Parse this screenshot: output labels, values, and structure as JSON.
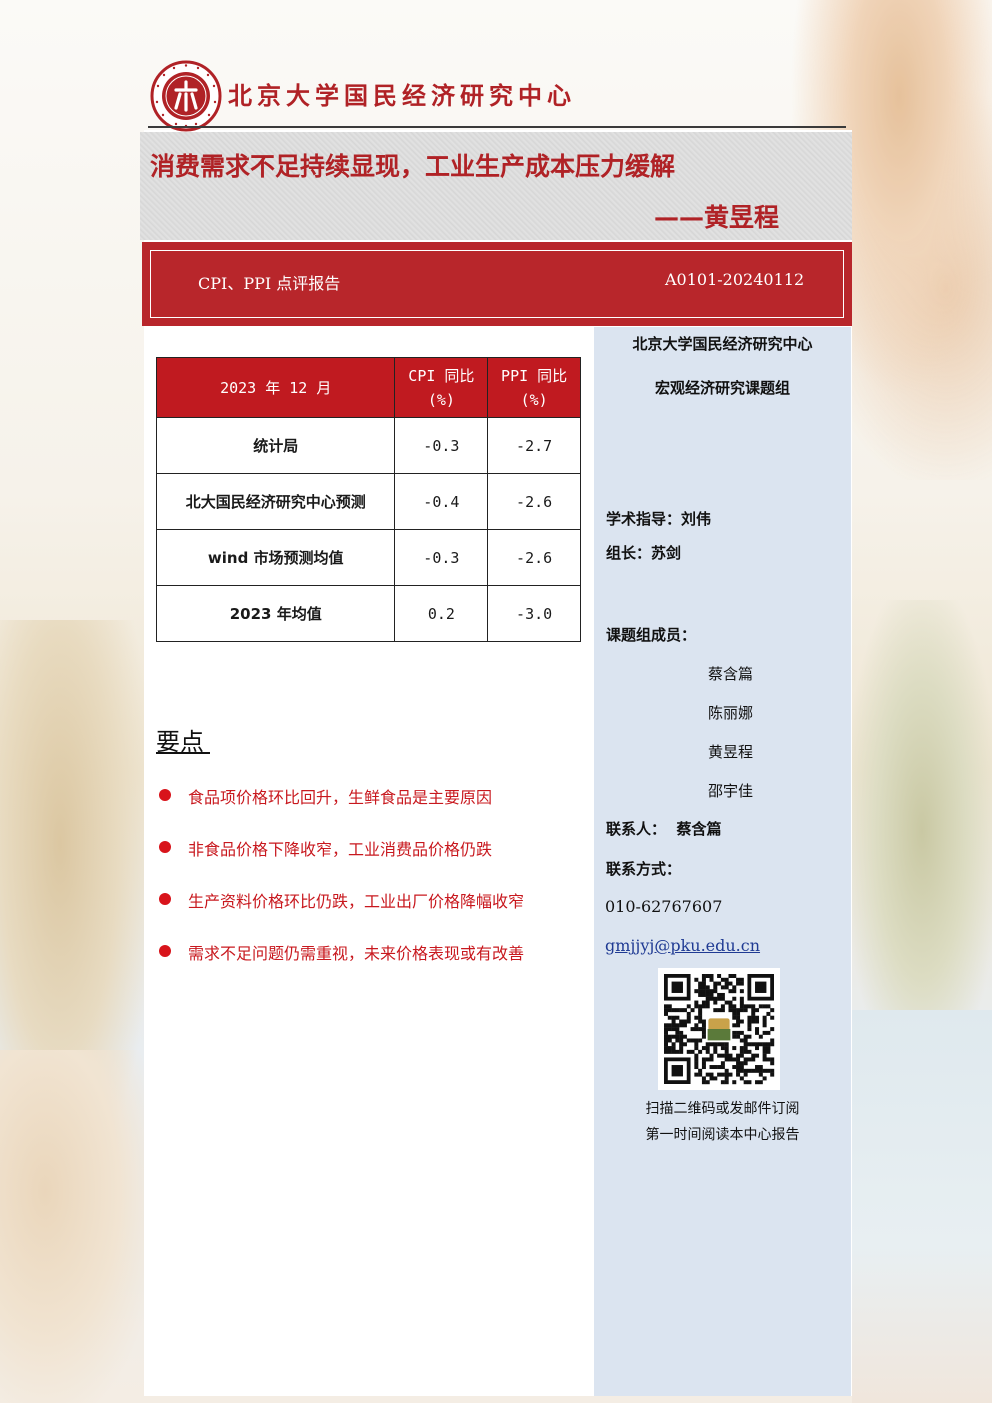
{
  "header": {
    "org_name": "北京大学国民经济研究中心",
    "logo": "peking-university-seal-icon",
    "logo_text": "PEKING UNIVERSITY 1898"
  },
  "title": {
    "main": "消费需求不足持续显现，工业生产成本压力缓解",
    "author": "——黄昱程"
  },
  "report": {
    "type": "CPI、PPI 点评报告",
    "code": "A0101-20240112"
  },
  "table": {
    "headers": [
      "2023 年 12 月",
      "CPI 同比\n(%)",
      "PPI 同比\n(%)"
    ],
    "header_lines": [
      [
        "2023 年 12 月"
      ],
      [
        "CPI 同比",
        "(%)"
      ],
      [
        "PPI 同比",
        "(%)"
      ]
    ],
    "rows": [
      {
        "name": "统计局",
        "cpi": "-0.3",
        "ppi": "-2.7"
      },
      {
        "name": "北大国民经济研究中心预测",
        "cpi": "-0.4",
        "ppi": "-2.6"
      },
      {
        "name": "wind 市场预测均值",
        "cpi": "-0.3",
        "ppi": "-2.6"
      },
      {
        "name": "2023 年均值",
        "cpi": "0.2",
        "ppi": "-3.0"
      }
    ]
  },
  "key_points": {
    "title": "要点",
    "items": [
      "食品项价格环比回升，生鲜食品是主要原因",
      "非食品价格下降收窄，工业消费品价格仍跌",
      "生产资料价格环比仍跌，工业出厂价格降幅收窄",
      "需求不足问题仍需重视，未来价格表现或有改善"
    ]
  },
  "sidebar": {
    "org": "北京大学国民经济研究中心",
    "group": "宏观经济研究课题组",
    "advisor": "学术指导：刘伟",
    "leader": "组长：苏剑",
    "members_label": "课题组成员：",
    "members": [
      "蔡含篇",
      "陈丽娜",
      "黄昱程",
      "邵宇佳"
    ],
    "contact_person": "联系人：  蔡含篇",
    "contact_label": "联系方式：",
    "phone": "010-62767607",
    "email": "gmjjyj@pku.edu.cn",
    "qr_icon": "qr-code-icon",
    "qr_caption_1": "扫描二维码或发邮件订阅",
    "qr_caption_2": "第一时间阅读本中心报告"
  },
  "colors": {
    "brand_red": "#b02226",
    "band_red": "#b8262b",
    "sidebar_blue": "#dbe4f0",
    "bullet_red": "#d8141b"
  }
}
